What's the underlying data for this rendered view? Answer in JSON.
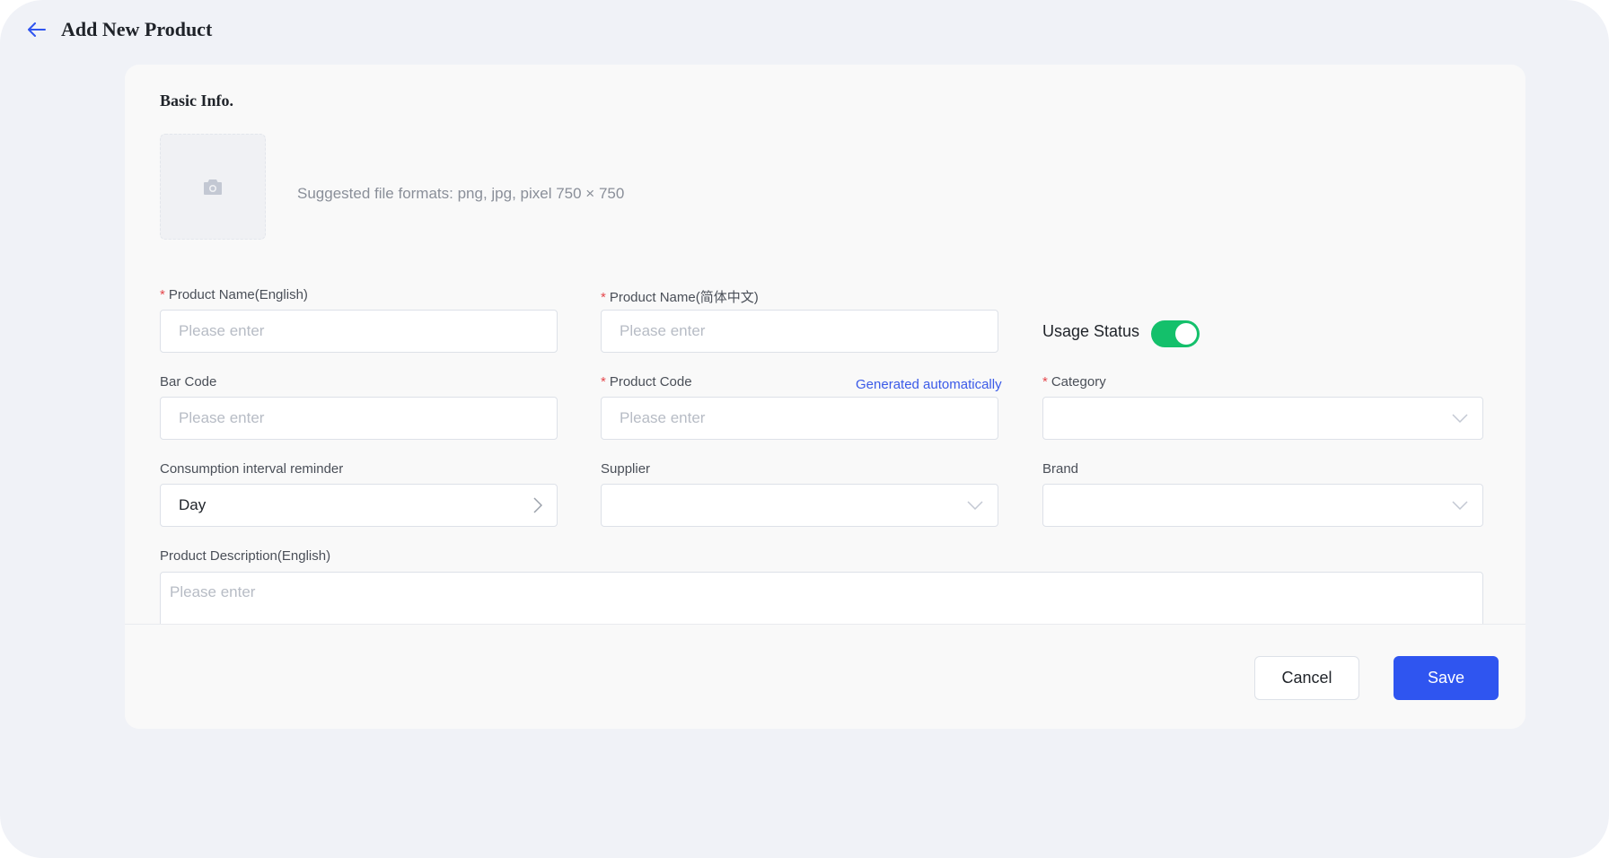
{
  "header": {
    "title": "Add New Product"
  },
  "basic_info": {
    "section_title": "Basic Info.",
    "upload_hint": "Suggested file formats: png, jpg, pixel 750 × 750"
  },
  "form": {
    "product_name_en": {
      "label": "Product Name(English)",
      "placeholder": "Please enter",
      "required": true
    },
    "product_name_zh": {
      "label": "Product Name(简体中文)",
      "placeholder": "Please enter",
      "required": true
    },
    "usage_status": {
      "label": "Usage Status",
      "enabled": true
    },
    "bar_code": {
      "label": "Bar Code",
      "placeholder": "Please enter"
    },
    "product_code": {
      "label": "Product Code",
      "placeholder": "Please enter",
      "required": true,
      "link": "Generated automatically"
    },
    "category": {
      "label": "Category",
      "value": "",
      "required": true
    },
    "consumption_interval": {
      "label": "Consumption interval reminder",
      "value": "Day"
    },
    "supplier": {
      "label": "Supplier",
      "value": ""
    },
    "brand": {
      "label": "Brand",
      "value": ""
    },
    "description_en": {
      "label": "Product Description(English)",
      "placeholder": "Please enter"
    },
    "required_mark": "*"
  },
  "footer": {
    "cancel_label": "Cancel",
    "save_label": "Save"
  },
  "colors": {
    "accent": "#2f55f0",
    "toggle_on": "#14c06b",
    "required": "#e5484d",
    "link": "#3a5ae8"
  },
  "icons": {
    "back": "arrow-left-icon",
    "upload": "camera-icon",
    "select": "chevron-down-icon",
    "picker": "chevron-right-icon"
  }
}
